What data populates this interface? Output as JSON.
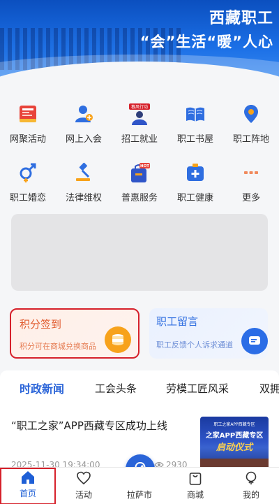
{
  "header": {
    "title": "西藏职工",
    "slogan": "“会”生活“暖”人心"
  },
  "grid": {
    "row1": [
      {
        "label": "网聚活动",
        "icon": "news-board-icon"
      },
      {
        "label": "网上入会",
        "icon": "user-join-icon"
      },
      {
        "label": "招工就业",
        "icon": "recruitment-icon",
        "badge": "春风行动"
      },
      {
        "label": "职工书屋",
        "icon": "book-icon"
      },
      {
        "label": "职工阵地",
        "icon": "location-pin-icon"
      }
    ],
    "row2": [
      {
        "label": "职工婚恋",
        "icon": "gender-symbol-icon"
      },
      {
        "label": "法律维权",
        "icon": "gavel-icon"
      },
      {
        "label": "普惠服务",
        "icon": "gift-bag-icon",
        "badge": "HOT"
      },
      {
        "label": "职工健康",
        "icon": "medical-kit-icon"
      },
      {
        "label": "更多",
        "icon": "more-dots-icon"
      }
    ]
  },
  "cards": {
    "points": {
      "title": "积分签到",
      "subtitle": "积分可在商城兑换商品",
      "icon": "coin-stack-icon"
    },
    "message": {
      "title": "职工留言",
      "subtitle": "职工反馈个人诉求通道",
      "icon": "chat-icon"
    }
  },
  "news": {
    "tabs": [
      "时政新闻",
      "工会头条",
      "劳模工匠风采",
      "双拥"
    ],
    "active_tab": 0,
    "items": [
      {
        "title": "“职工之家”APP西藏专区成功上线",
        "time": "2025-11-30 19:34:00",
        "views": "2930",
        "thumb_line1": "职工之家APP西藏专区",
        "thumb_line2": "之家APP西藏专区",
        "thumb_line3": "启动仪式"
      }
    ]
  },
  "bottom_nav": [
    {
      "label": "首页",
      "icon": "home-icon",
      "active": true
    },
    {
      "label": "活动",
      "icon": "heart-icon",
      "active": false
    },
    {
      "label": "拉萨市",
      "icon": "map-location-icon",
      "active": false
    },
    {
      "label": "商城",
      "icon": "shopping-bag-icon",
      "active": false
    },
    {
      "label": "我的",
      "icon": "profile-icon",
      "active": false
    }
  ],
  "colors": {
    "brand_blue": "#2a64d8",
    "banner_blue": "#1b6fe6",
    "points_orange": "#e0582a",
    "highlight_red": "#d6212b"
  }
}
